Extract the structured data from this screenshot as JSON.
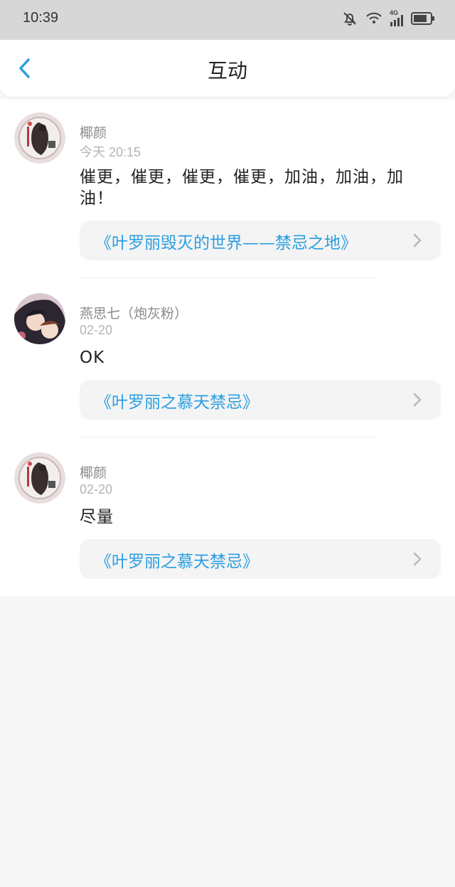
{
  "status_bar": {
    "time": "10:39",
    "icons": [
      "bell-muted-icon",
      "wifi-icon",
      "signal-4g-icon",
      "battery-icon"
    ],
    "network": "4G"
  },
  "header": {
    "title": "互动",
    "back_icon": "chevron-left-icon"
  },
  "comments": [
    {
      "user": "椰颜",
      "time": "今天 20:15",
      "text": "催更，催更，催更，催更，加油，加油，加油！",
      "book": "《叶罗丽毁灭的世界——禁忌之地》"
    },
    {
      "user": "燕思七（炮灰粉）",
      "time": "02-20",
      "text": "OK",
      "book": "《叶罗丽之慕天禁忌》"
    },
    {
      "user": "椰颜",
      "time": "02-20",
      "text": "尽量",
      "book": "《叶罗丽之慕天禁忌》"
    }
  ],
  "colors": {
    "accent": "#2a9ee0",
    "status_bar": "#d7d7d7",
    "background": "#f8f7f8"
  }
}
